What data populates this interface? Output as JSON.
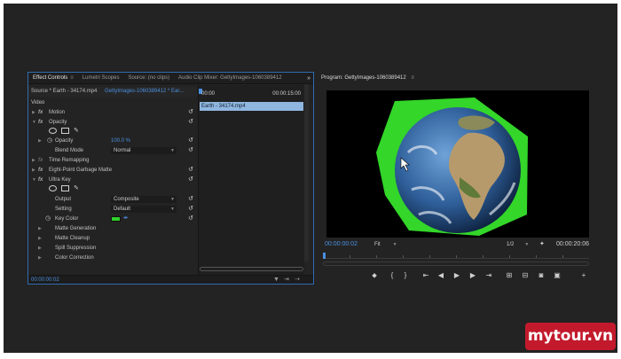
{
  "left_panel": {
    "tabs": [
      {
        "label": "Effect Controls",
        "active": true,
        "menu_glyph": "≡"
      },
      {
        "label": "Lumetri Scopes",
        "active": false
      },
      {
        "label": "Source: (no clips)",
        "active": false
      },
      {
        "label": "Audio Clip Mixer: GettyImages-1060389412",
        "active": false
      }
    ],
    "more_glyph": "»",
    "source_label": "Source * Earth - 34174.mp4",
    "sequence_label": "GettyImages-1060389412 * Ear...",
    "timeline": {
      "start_tc": "00:00",
      "end_tc": "00:00:15:00",
      "clip_label": "Earth - 34174.mp4"
    },
    "effects": {
      "video_label": "Video",
      "motion": "Motion",
      "opacity": "Opacity",
      "opacity_prop": "Opacity",
      "opacity_value": "100.0 %",
      "blend_mode_label": "Blend Mode",
      "blend_mode_value": "Normal",
      "time_remapping": "Time Remapping",
      "eight_point": "Eight-Point Garbage Matte",
      "ultra_key": "Ultra Key",
      "output_label": "Output",
      "output_value": "Composite",
      "setting_label": "Setting",
      "setting_value": "Default",
      "key_color_label": "Key Color",
      "key_color_hex": "#2fd12a",
      "matte_generation": "Matte Generation",
      "matte_cleanup": "Matte Cleanup",
      "spill_suppression": "Spill Suppression",
      "color_correction": "Color Correction",
      "fx_glyph": "fx"
    },
    "footer_tc": "00:00:00:02"
  },
  "program": {
    "title": "Program: GettyImages-1060389412",
    "menu_glyph": "≡",
    "tc_left": "00:00:00:02",
    "fit_label": "Fit",
    "resolution": "1/2",
    "tc_right": "00:00:20:06"
  },
  "colors": {
    "accent_blue": "#4a8fe0",
    "green_screen": "#33d629",
    "panel_bg": "#232323",
    "watermark_red": "#c21a2c"
  },
  "watermark": "mytour.vn"
}
